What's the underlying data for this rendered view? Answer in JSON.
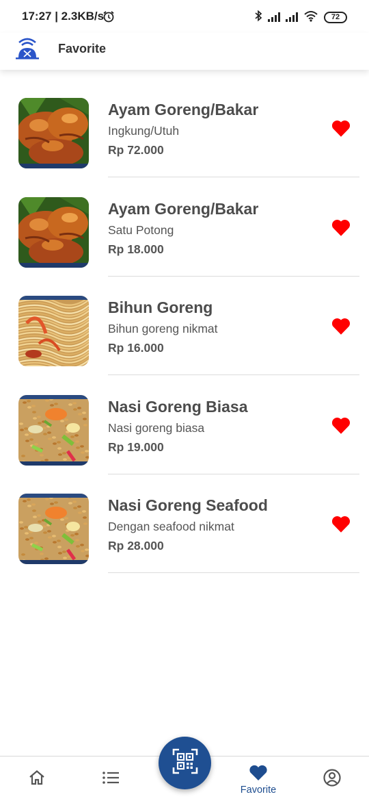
{
  "status_bar": {
    "time": "17:27 | 2.3KB/s",
    "battery": "72",
    "icons": [
      "alarm-icon",
      "bluetooth-icon",
      "signal-icon",
      "signal-icon",
      "wifi-icon",
      "battery-icon"
    ]
  },
  "header": {
    "logo_icon": "wifi-restaurant-logo",
    "title": "Favorite"
  },
  "favorites": [
    {
      "name": "Ayam Goreng/Bakar",
      "description": "Ingkung/Utuh",
      "price": "Rp 72.000",
      "image": "fried-chicken",
      "favorited": true
    },
    {
      "name": "Ayam Goreng/Bakar",
      "description": "Satu Potong",
      "price": "Rp 18.000",
      "image": "fried-chicken",
      "favorited": true
    },
    {
      "name": "Bihun Goreng",
      "description": "Bihun goreng nikmat",
      "price": "Rp 16.000",
      "image": "fried-noodles",
      "favorited": true
    },
    {
      "name": "Nasi Goreng Biasa",
      "description": "Nasi goreng biasa",
      "price": "Rp 19.000",
      "image": "fried-rice",
      "favorited": true
    },
    {
      "name": "Nasi Goreng Seafood",
      "description": "Dengan seafood nikmat",
      "price": "Rp 28.000",
      "image": "fried-rice",
      "favorited": true
    }
  ],
  "bottom_nav": {
    "items": [
      {
        "icon": "home-icon",
        "label": ""
      },
      {
        "icon": "list-icon",
        "label": ""
      },
      {
        "icon": "qr-code-icon",
        "label": ""
      },
      {
        "icon": "heart-icon",
        "label": "Favorite",
        "active": true
      },
      {
        "icon": "account-icon",
        "label": ""
      }
    ]
  },
  "colors": {
    "accent": "#1f4f92",
    "heart": "#ff0000",
    "text": "#4c4c4c",
    "divider": "#dcdcdc"
  }
}
